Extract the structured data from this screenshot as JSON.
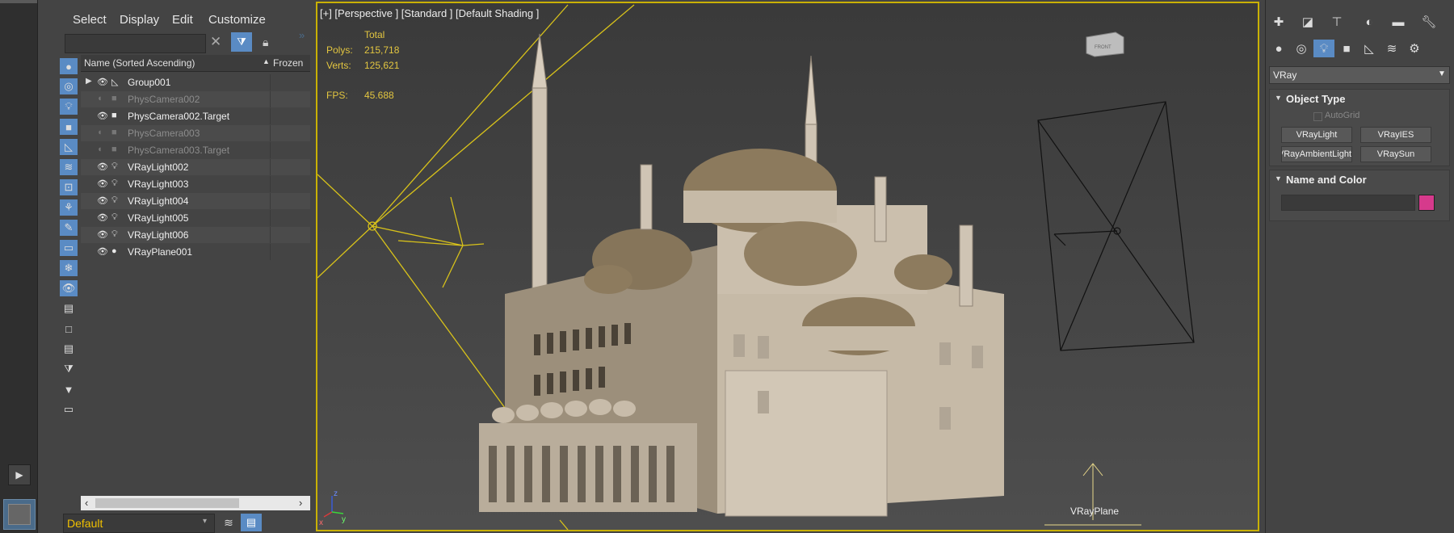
{
  "menu": {
    "select": "Select",
    "display": "Display",
    "edit": "Edit",
    "customize": "Customize"
  },
  "explorer": {
    "column_name": "Name (Sorted Ascending)",
    "column_frozen": "Frozen",
    "rows": [
      {
        "name": "Group001",
        "frozen": false
      },
      {
        "name": "PhysCamera002",
        "frozen": true
      },
      {
        "name": "PhysCamera002.Target",
        "frozen": false
      },
      {
        "name": "PhysCamera003",
        "frozen": true
      },
      {
        "name": "PhysCamera003.Target",
        "frozen": true
      },
      {
        "name": "VRayLight002",
        "frozen": false
      },
      {
        "name": "VRayLight003",
        "frozen": false
      },
      {
        "name": "VRayLight004",
        "frozen": false
      },
      {
        "name": "VRayLight005",
        "frozen": false
      },
      {
        "name": "VRayLight006",
        "frozen": false
      },
      {
        "name": "VRayPlane001",
        "frozen": false
      }
    ],
    "layer": "Default"
  },
  "viewport": {
    "label": "[+] [Perspective ] [Standard ] [Default Shading ]",
    "stats": {
      "total_label": "Total",
      "polys_label": "Polys:",
      "polys": "215,718",
      "verts_label": "Verts:",
      "verts": "125,621",
      "fps_label": "FPS:",
      "fps": "45.688"
    },
    "vrayplane_label": "VRayPlane"
  },
  "command_panel": {
    "renderer": "VRay",
    "object_type_title": "Object Type",
    "autogrid": "AutoGrid",
    "buttons": [
      "VRayLight",
      "VRayIES",
      "VRayAmbientLight",
      "VRaySun"
    ],
    "name_color_title": "Name and Color",
    "object_color": "#d63a8c"
  },
  "colors": {
    "accent": "#5a8bc4",
    "viewport_border": "#c9b100",
    "stats": "#e3c640"
  }
}
